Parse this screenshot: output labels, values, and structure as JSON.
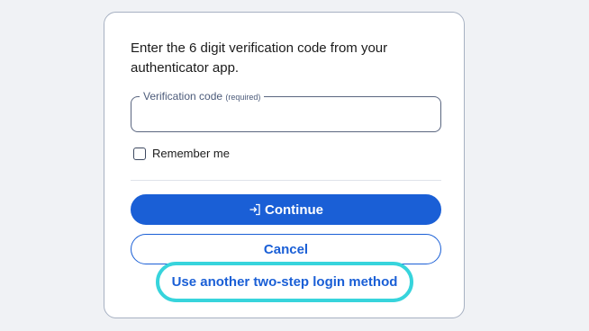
{
  "form": {
    "instructions": "Enter the 6 digit verification code from your authenticator app.",
    "code_label": "Verification code",
    "code_required": "(required)",
    "code_value": "",
    "remember_label": "Remember me",
    "remember_checked": false
  },
  "actions": {
    "continue_label": "Continue",
    "continue_icon": "login-arrow-icon",
    "cancel_label": "Cancel",
    "alt_method_label": "Use another two-step login method"
  },
  "colors": {
    "primary": "#1a5fd6",
    "highlight": "#37d4dc",
    "card_border": "#a7b1c2",
    "background": "#f0f2f5"
  }
}
